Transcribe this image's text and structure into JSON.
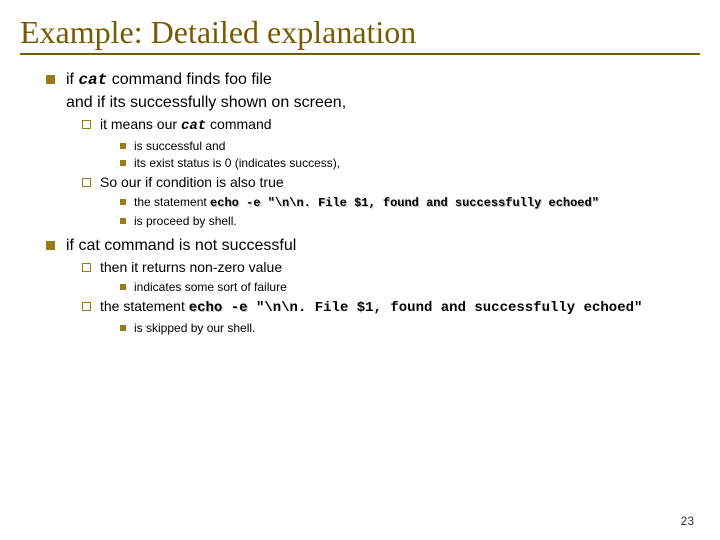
{
  "title": "Example: Detailed explanation",
  "b1": {
    "prefix": "if ",
    "cmd": "cat",
    "rest": " command finds foo file",
    "line2": "and if its successfully shown on screen,"
  },
  "b1s1": {
    "prefix": "it means our ",
    "cmd": "cat",
    "rest": " command"
  },
  "b1s1a": "is successful and",
  "b1s1b": "its exist status is 0 (indicates success),",
  "b1s2": "So our if condition is also true",
  "b1s2a": {
    "prefix": "the statement ",
    "code": "echo -e \"\\n\\n. File $1, found and successfully echoed\""
  },
  "b1s2b": "is proceed by shell.",
  "b2": "if cat command is not successful",
  "b2s1": "then it returns non-zero value",
  "b2s1a": "indicates some sort of failure",
  "b2s2": {
    "prefix": "the statement ",
    "code": "echo -e ",
    "rest": "\"\\n\\n. File $1, found and successfully echoed\""
  },
  "b2s3": "is skipped by our shell.",
  "pagenum": "23"
}
